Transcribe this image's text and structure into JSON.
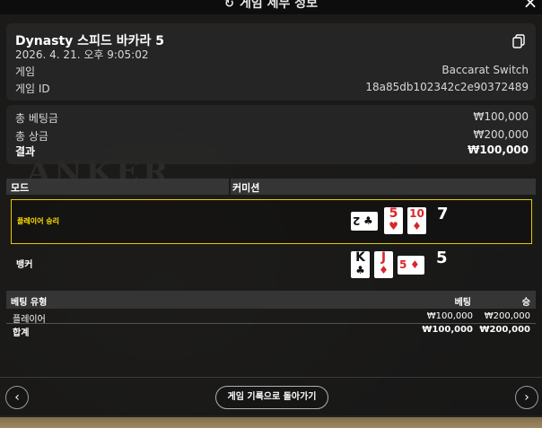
{
  "header": {
    "title": "게임 세부 정보",
    "title_icon": "history-icon",
    "close_icon": "×"
  },
  "summary": {
    "title": "Dynasty 스피드 바카라 5",
    "datetime": "2026. 4. 21. 오후 9:05:02",
    "game_label": "게임",
    "game_value": "Baccarat Switch",
    "game_id_label": "게임 ID",
    "game_id_value": "18a85db102342c2e90372489"
  },
  "totals": {
    "bet_label": "총 베팅금",
    "bet_value": "₩100,000",
    "payout_label": "총 상금",
    "payout_value": "₩200,000",
    "result_label": "결과",
    "result_value": "₩100,000"
  },
  "grid": {
    "mode_label": "모드",
    "commission_label": "커미션"
  },
  "hands": [
    {
      "label": "플레이어 승리",
      "score": "7",
      "winner": true,
      "cards": [
        {
          "rank": "2",
          "suit": "♣",
          "color": "black",
          "side": true
        },
        {
          "rank": "5",
          "suit": "♥",
          "color": "red",
          "side": false
        },
        {
          "rank": "10",
          "suit": "♦",
          "color": "red",
          "side": false
        }
      ]
    },
    {
      "label": "뱅커",
      "score": "5",
      "winner": false,
      "cards": [
        {
          "rank": "K",
          "suit": "♣",
          "color": "black",
          "side": false
        },
        {
          "rank": "J",
          "suit": "♦",
          "color": "red",
          "side": false
        },
        {
          "rank": "5",
          "suit": "♦",
          "color": "red",
          "side": true
        }
      ]
    }
  ],
  "bets": {
    "headers": [
      "베팅 유형",
      "베팅",
      "승"
    ],
    "rows": [
      {
        "type": "플레이어",
        "bet": "₩100,000",
        "win": "₩200,000"
      }
    ],
    "total": {
      "type": "합계",
      "bet": "₩100,000",
      "win": "₩200,000"
    }
  },
  "footer": {
    "back_label": "게임 기록으로 돌아가기",
    "prev_icon": "‹",
    "next_icon": "›"
  },
  "colors": {
    "winner_border": "#e8c800",
    "red_suit": "#d9262c"
  }
}
